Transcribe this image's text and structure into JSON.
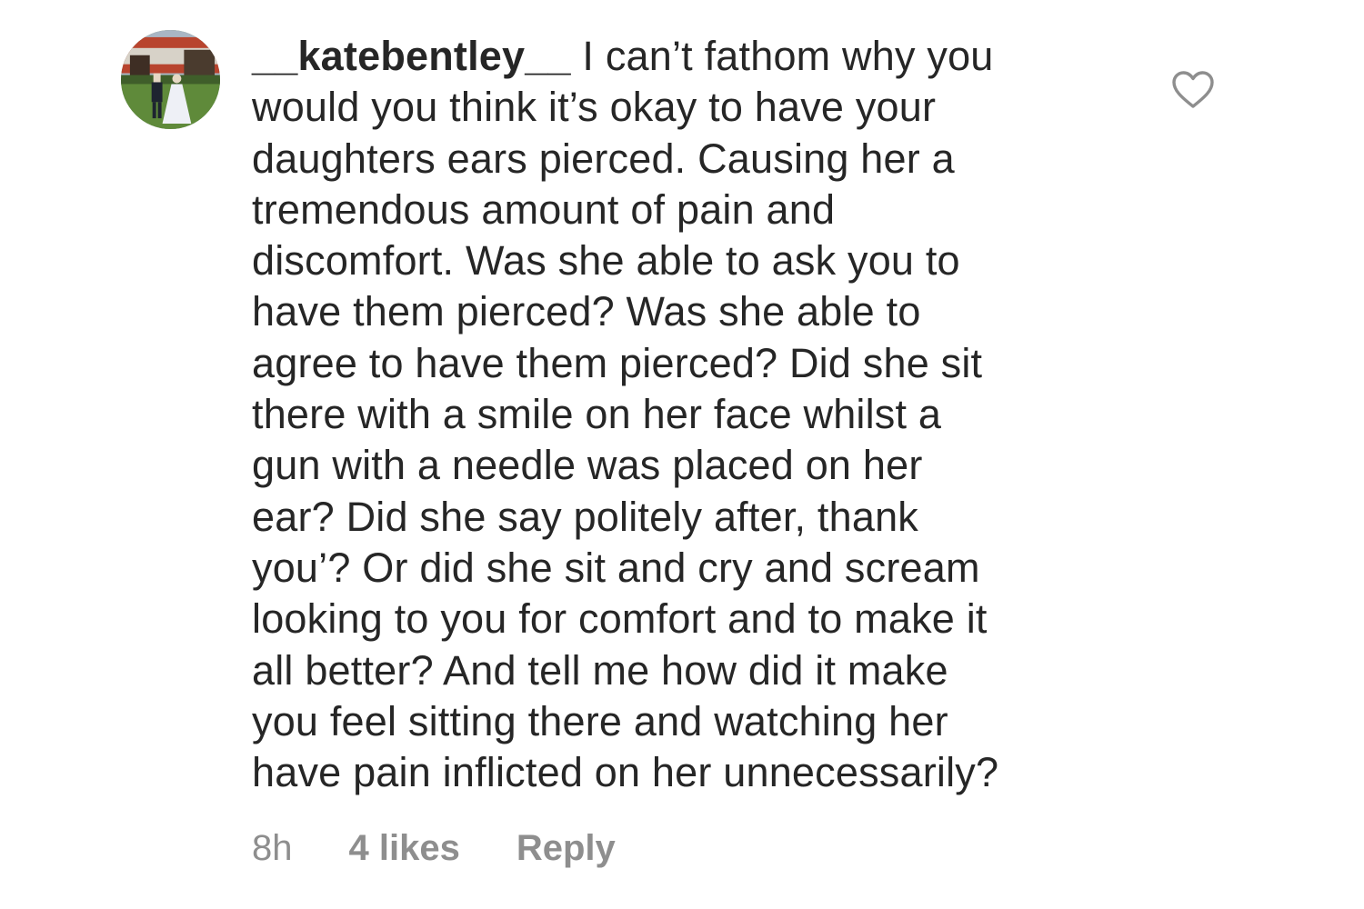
{
  "comment": {
    "username": "__katebentley__",
    "text": " I can’t fathom why you\nwould you think it’s okay to have your\ndaughters ears pierced. Causing her a\ntremendous amount of pain and\ndiscomfort. Was she able to ask you to\nhave them pierced? Was she able to\nagree to have them pierced? Did she sit\nthere with a smile on her face whilst a\ngun with a needle was placed on her\near? Did she say politely after, thank\nyou’? Or did she sit and cry and scream\nlooking to you for comfort and to make it\nall better? And tell me how did it make\nyou feel sitting there and watching her\nhave pain inflicted on her unnecessarily?",
    "time": "8h",
    "likes": "4 likes",
    "reply_label": "Reply",
    "like_icon": "heart-outline-icon",
    "avatar_icon": "profile-photo"
  },
  "colors": {
    "text": "#262626",
    "meta": "#8e8e8e",
    "background": "#ffffff"
  }
}
